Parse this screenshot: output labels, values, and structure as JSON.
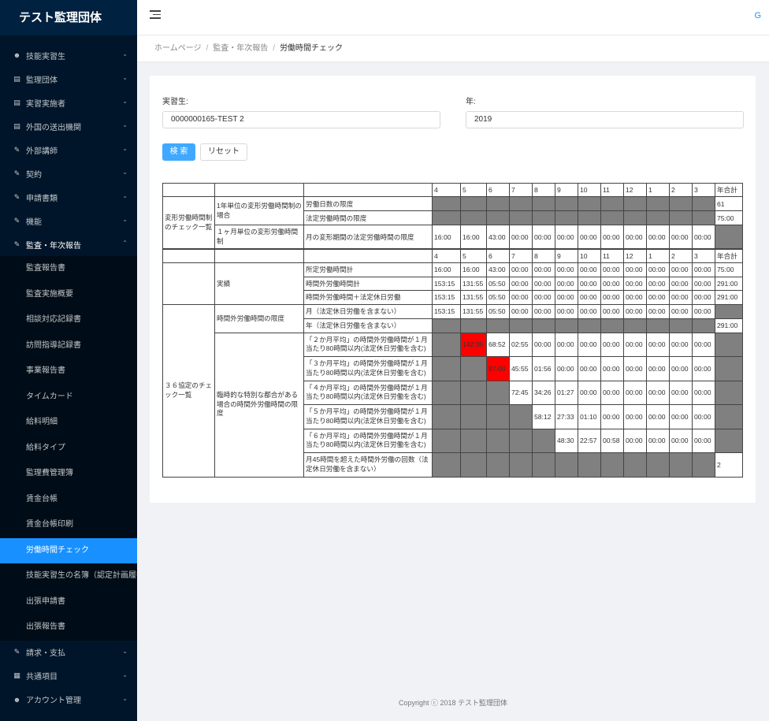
{
  "app": {
    "title": "テスト監理団体"
  },
  "colors": {
    "sidebar": "#001529",
    "accent": "#1890ff",
    "danger": "#ff0000",
    "disabled": "#808080"
  },
  "sidebar": {
    "items": [
      {
        "label": "技能実習生",
        "icon": "user-icon"
      },
      {
        "label": "監理団体",
        "icon": "building-icon"
      },
      {
        "label": "実習実施者",
        "icon": "building-icon"
      },
      {
        "label": "外国の送出機関",
        "icon": "building-icon"
      },
      {
        "label": "外部講師",
        "icon": "edit-icon"
      },
      {
        "label": "契約",
        "icon": "edit-icon"
      },
      {
        "label": "申請書類",
        "icon": "edit-icon"
      },
      {
        "label": "機能",
        "icon": "edit-icon"
      },
      {
        "label": "監査・年次報告",
        "icon": "edit-icon"
      }
    ],
    "subitems": [
      "監査報告書",
      "監査実施概要",
      "相談対応記録書",
      "訪問指導記録書",
      "事業報告書",
      "タイムカード",
      "給料明細",
      "給料タイプ",
      "監理費管理簿",
      "賃金台帳",
      "賃金台帳印刷",
      "労働時間チェック",
      "技能実習生の名簿（認定計画履行",
      "出張申請書",
      "出張報告書"
    ],
    "bottom": [
      {
        "label": "請求・支払",
        "icon": "edit-icon"
      },
      {
        "label": "共通項目",
        "icon": "table-icon"
      },
      {
        "label": "アカウント管理",
        "icon": "user-icon"
      }
    ]
  },
  "header": {
    "user_initial": "G"
  },
  "breadcrumb": {
    "home": "ホームページ",
    "parent": "監査・年次報告",
    "current": "労働時間チェック",
    "sep": "/"
  },
  "form": {
    "trainee_label": "実習生:",
    "trainee_value": "0000000165-TEST 2",
    "year_label": "年:",
    "year_value": "2019",
    "search_button": "検 索",
    "reset_button": "リセット"
  },
  "table1": {
    "months": [
      "4",
      "5",
      "6",
      "7",
      "8",
      "9",
      "10",
      "11",
      "12",
      "1",
      "2",
      "3"
    ],
    "total_header": "年合計",
    "section_label": "変形労働時間制のチェック一覧",
    "group1_label": "1年単位の変形労働時間制の場合",
    "group2_label": "１ヶ月単位の変形労働時間制",
    "row1_label": "労働日数の限度",
    "row1_total": "61",
    "row2_label": "法定労働時間の限度",
    "row2_total": "75:00",
    "row3_label": "月の変形期間の法定労働時間の限度",
    "row3_values": [
      "16:00",
      "16:00",
      "43:00",
      "00:00",
      "00:00",
      "00:00",
      "00:00",
      "00:00",
      "00:00",
      "00:00",
      "00:00",
      "00:00"
    ]
  },
  "table2": {
    "months": [
      "4",
      "5",
      "6",
      "7",
      "8",
      "9",
      "10",
      "11",
      "12",
      "1",
      "2",
      "3"
    ],
    "total_header": "年合計",
    "actual_label": "実績",
    "actual_rows": [
      {
        "label": "所定労働時間計",
        "values": [
          "16:00",
          "16:00",
          "43:00",
          "00:00",
          "00:00",
          "00:00",
          "00:00",
          "00:00",
          "00:00",
          "00:00",
          "00:00",
          "00:00"
        ],
        "total": "75:00"
      },
      {
        "label": "時間外労働時間計",
        "values": [
          "153:15",
          "131:55",
          "05:50",
          "00:00",
          "00:00",
          "00:00",
          "00:00",
          "00:00",
          "00:00",
          "00:00",
          "00:00",
          "00:00"
        ],
        "total": "291:00"
      },
      {
        "label": "時間外労働時間＋法定休日労働",
        "values": [
          "153:15",
          "131:55",
          "05:50",
          "00:00",
          "00:00",
          "00:00",
          "00:00",
          "00:00",
          "00:00",
          "00:00",
          "00:00",
          "00:00"
        ],
        "total": "291:00"
      }
    ],
    "section36_label": "３６協定のチェック一覧",
    "limit_label": "時間外労働時間の限度",
    "month_limit_label": "月（法定休日労働を含まない）",
    "month_limit_values": [
      "153:15",
      "131:55",
      "05:50",
      "00:00",
      "00:00",
      "00:00",
      "00:00",
      "00:00",
      "00:00",
      "00:00",
      "00:00",
      "00:00"
    ],
    "year_limit_label": "年（法定休日労働を含まない）",
    "year_limit_total": "291:00",
    "special_label": "臨時的な特別な都合がある場合の時間外労働時間の限度",
    "avg_rows": [
      {
        "label": "「２か月平均」の時間外労働時間が１月当たり80時間以内(法定休日労働を含む)",
        "start": 1,
        "values": [
          "142:35",
          "68:52",
          "02:55",
          "00:00",
          "00:00",
          "00:00",
          "00:00",
          "00:00",
          "00:00",
          "00:00",
          "00:00"
        ],
        "red": [
          0
        ]
      },
      {
        "label": "「３か月平均」の時間外労働時間が１月当たり80時間以内(法定休日労働を含む)",
        "start": 2,
        "values": [
          "97:00",
          "45:55",
          "01:56",
          "00:00",
          "00:00",
          "00:00",
          "00:00",
          "00:00",
          "00:00",
          "00:00"
        ],
        "red": [
          0
        ]
      },
      {
        "label": "「４か月平均」の時間外労働時間が１月当たり80時間以内(法定休日労働を含む)",
        "start": 3,
        "values": [
          "72:45",
          "34:26",
          "01:27",
          "00:00",
          "00:00",
          "00:00",
          "00:00",
          "00:00",
          "00:00"
        ],
        "red": []
      },
      {
        "label": "「５か月平均」の時間外労働時間が１月当たり80時間以内(法定休日労働を含む)",
        "start": 4,
        "values": [
          "58:12",
          "27:33",
          "01:10",
          "00:00",
          "00:00",
          "00:00",
          "00:00",
          "00:00"
        ],
        "red": []
      },
      {
        "label": "「６か月平均」の時間外労働時間が１月当たり80時間以内(法定休日労働を含む)",
        "start": 5,
        "values": [
          "48:30",
          "22:57",
          "00:58",
          "00:00",
          "00:00",
          "00:00",
          "00:00"
        ],
        "red": []
      }
    ],
    "over45_label": "月45時間を超えた時間外労働の回数（法定休日労働を含まない）",
    "over45_total": "2"
  },
  "footer": {
    "text": "Copyright ⓒ 2018 テスト監理団体"
  }
}
